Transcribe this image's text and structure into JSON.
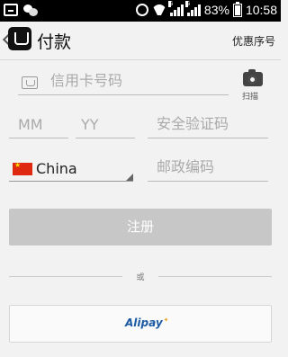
{
  "status_bar": {
    "icons": [
      "screenshot-box-icon",
      "chat-bubble-icon",
      "alarm-icon",
      "wifi-icon",
      "signal-icon",
      "signal-icon",
      "battery-icon"
    ],
    "network_1": "G",
    "network_2": "G",
    "battery": "83%",
    "time": "10:58"
  },
  "header": {
    "title": "付款",
    "promo_code": "优惠序号"
  },
  "form": {
    "card_number_placeholder": "信用卡号码",
    "scan_label": "扫描",
    "month_placeholder": "MM",
    "year_placeholder": "YY",
    "cvv_placeholder": "安全验证码",
    "country": "China",
    "postal_placeholder": "邮政编码",
    "register_label": "注册",
    "or_label": "或",
    "alipay_label": "Alipay"
  },
  "colors": {
    "register_disabled": "#c7c7c7",
    "alipay_blue": "#1c5aa5",
    "flag_red": "#de2910"
  }
}
